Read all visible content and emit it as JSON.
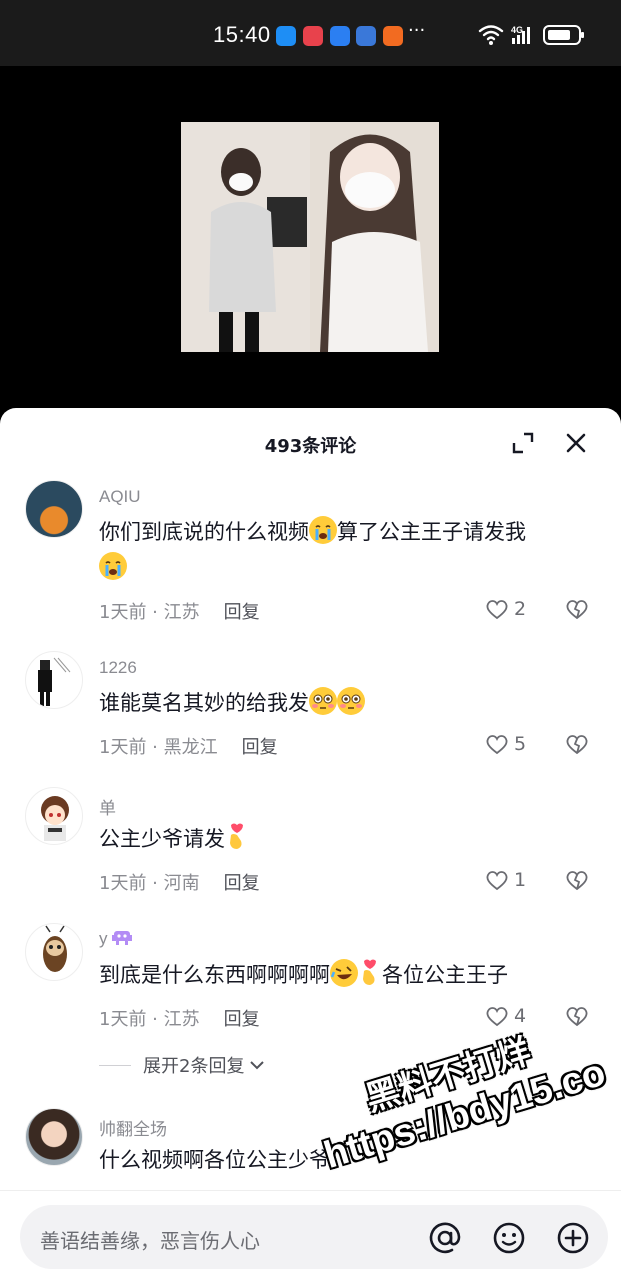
{
  "status_bar": {
    "time": "15:40",
    "dots": "···",
    "network": "4G"
  },
  "sheet": {
    "title": "493条评论"
  },
  "comments": [
    {
      "user": "AQIU",
      "text_a": "你们到底说的什么视频",
      "text_b": "算了公主王子请发我",
      "time": "1天前",
      "location": "江苏",
      "reply_label": "回复",
      "likes": "2"
    },
    {
      "user": "1226",
      "text_a": "谁能莫名其妙的给我发",
      "time": "1天前",
      "location": "黑龙江",
      "reply_label": "回复",
      "likes": "5"
    },
    {
      "user": "单",
      "text_a": "公主少爷请发",
      "time": "1天前",
      "location": "河南",
      "reply_label": "回复",
      "likes": "1"
    },
    {
      "user": "y",
      "text_a": "到底是什么东西啊啊啊啊",
      "text_b": "各位公主王子",
      "time": "1天前",
      "location": "江苏",
      "reply_label": "回复",
      "likes": "4"
    },
    {
      "user": "帅翻全场",
      "text_a": "什么视频啊各位公主少爷"
    }
  ],
  "expand_replies": "展开2条回复",
  "input": {
    "placeholder": "善语结善缘，恶言伤人心"
  },
  "icons": {
    "expand": "expand-icon",
    "close": "close-icon",
    "like": "heart-outline-icon",
    "dislike": "broken-heart-icon",
    "mention": "at-icon",
    "emoji": "smiley-icon",
    "add": "plus-circle-icon"
  },
  "watermark": {
    "line1": "黑料不打烊",
    "line2": "https://bdy15.co"
  },
  "colors": {
    "text_primary": "#161823",
    "text_secondary": "#8a8b91",
    "sheet_bg": "#ffffff"
  }
}
